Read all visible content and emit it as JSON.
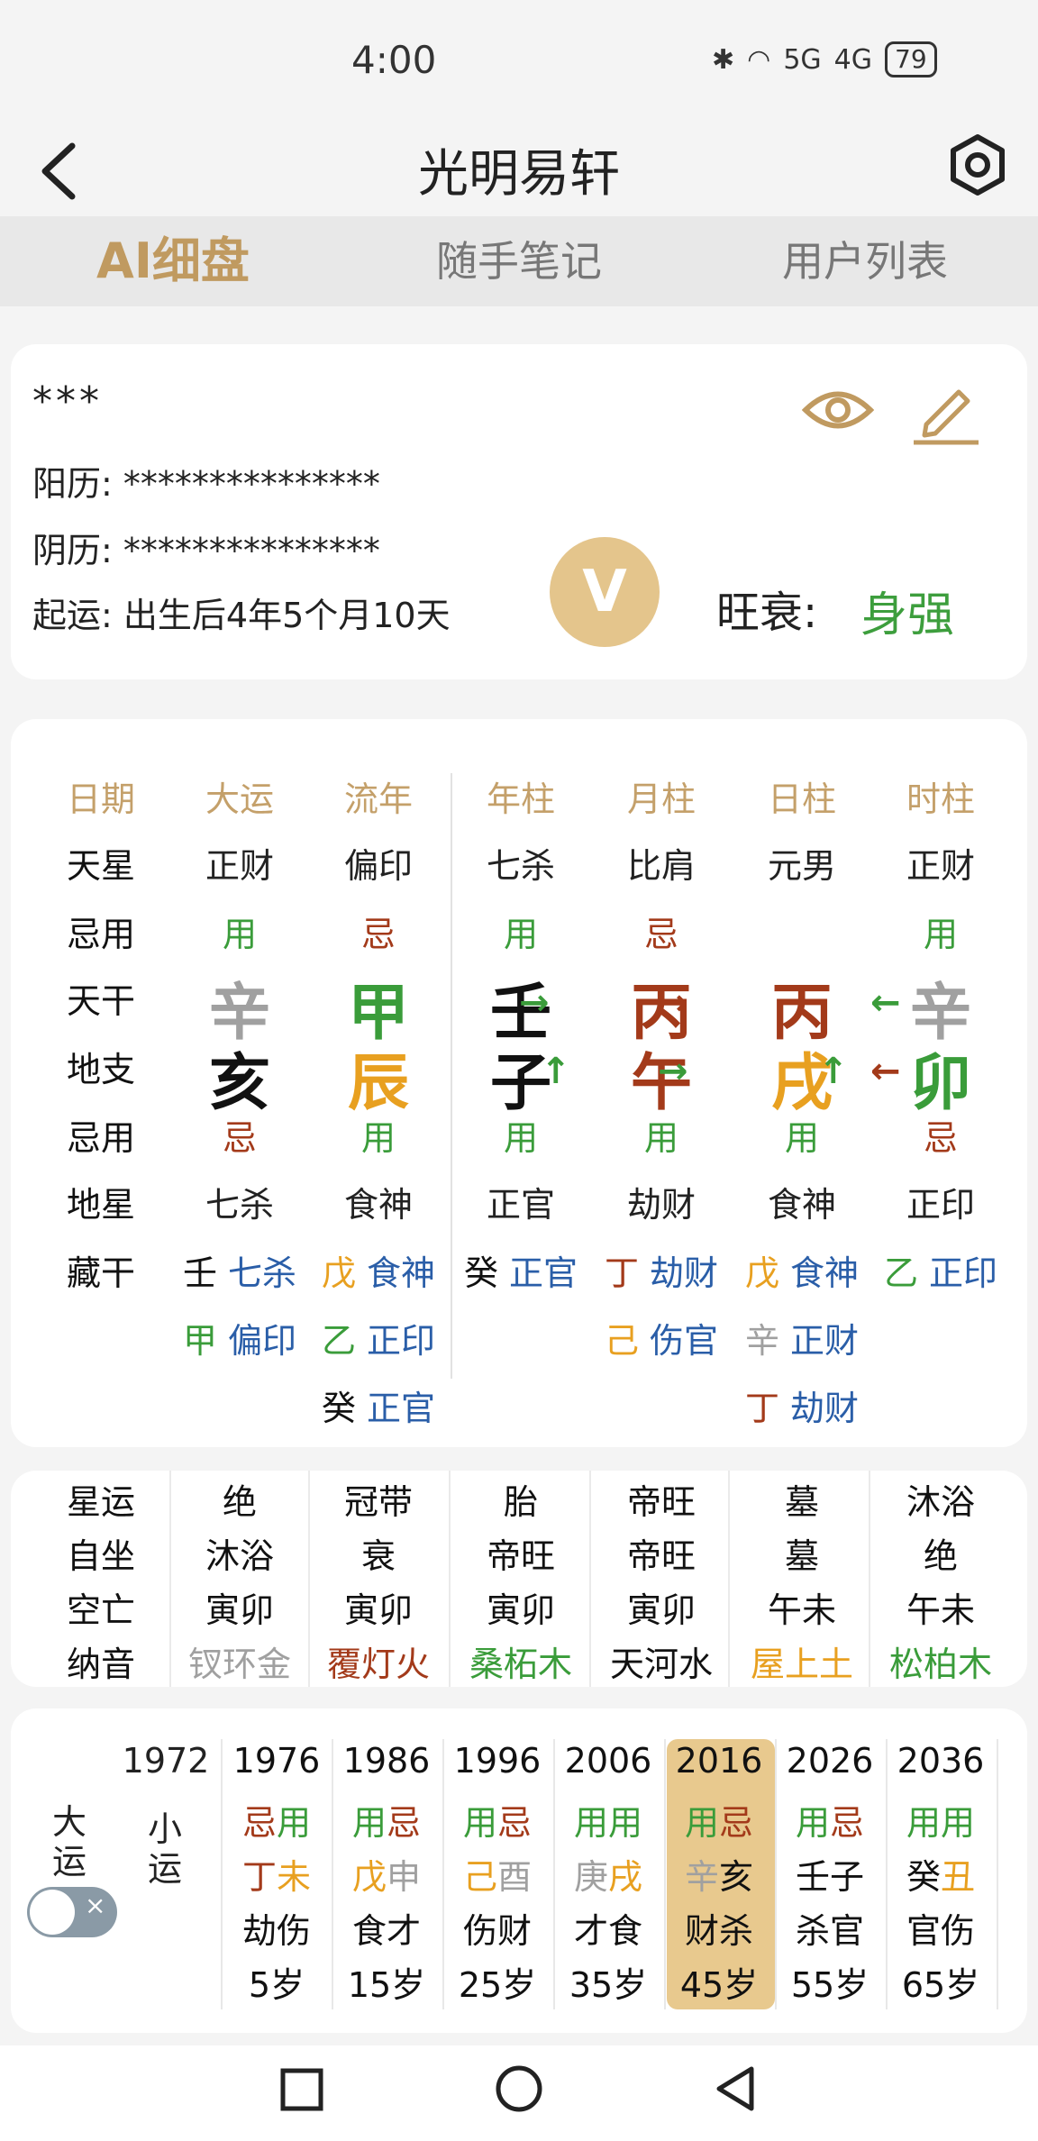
{
  "status": {
    "time": "4:00",
    "battery": "79",
    "signal1": "5G",
    "signal2": "4G"
  },
  "header": {
    "title": "光明易轩"
  },
  "tabs": [
    "AI细盘",
    "随手笔记",
    "用户列表"
  ],
  "profile": {
    "name": "***",
    "solar_label": "阳历:",
    "solar_value": "***************",
    "lunar_label": "阴历:",
    "lunar_value": "***************",
    "qiyun_label": "起运:",
    "qiyun_value": "出生后4年5个月10天",
    "vip_label": "V",
    "wangshuai_label": "旺衰:",
    "wangshuai_value": "身强"
  },
  "pillars": {
    "headers": [
      "日期",
      "大运",
      "流年",
      "年柱",
      "月柱",
      "日柱",
      "时柱"
    ],
    "rows": [
      [
        "天星",
        "正财",
        "偏印",
        "七杀",
        "比肩",
        "元男",
        "正财"
      ],
      [
        "忌用",
        "用",
        "忌",
        "用",
        "忌",
        "",
        "用"
      ],
      [
        "天干",
        "辛",
        "甲",
        "壬",
        "丙",
        "丙",
        "辛"
      ],
      [
        "地支",
        "亥",
        "辰",
        "子",
        "午",
        "戌",
        "卯"
      ],
      [
        "忌用",
        "忌",
        "用",
        "用",
        "用",
        "用",
        "忌"
      ],
      [
        "地星",
        "七杀",
        "食神",
        "正官",
        "劫财",
        "食神",
        "正印"
      ]
    ],
    "canggan_label": "藏干",
    "canggan": [
      [
        [
          "壬",
          "七杀"
        ],
        [
          "甲",
          "偏印"
        ]
      ],
      [
        [
          "戊",
          "食神"
        ],
        [
          "乙",
          "正印"
        ],
        [
          "癸",
          "正官"
        ]
      ],
      [
        [
          "癸",
          "正官"
        ]
      ],
      [
        [
          "丁",
          "劫财"
        ],
        [
          "己",
          "伤官"
        ]
      ],
      [
        [
          "戊",
          "食神"
        ],
        [
          "辛",
          "正财"
        ],
        [
          "丁",
          "劫财"
        ]
      ],
      [
        [
          "乙",
          "正印"
        ]
      ]
    ],
    "arrows": {
      "year_stem": "→",
      "year_branch": "↑",
      "month_stem": "→",
      "month_branch": "→",
      "day_branch": "↑",
      "hour_stem": "←",
      "hour_branch": "←"
    }
  },
  "extra": {
    "labels": [
      "星运",
      "自坐",
      "空亡",
      "纳音"
    ],
    "cols": [
      [
        "绝",
        "沐浴",
        "寅卯",
        "钗环金"
      ],
      [
        "冠带",
        "衰",
        "寅卯",
        "覆灯火"
      ],
      [
        "胎",
        "帝旺",
        "寅卯",
        "桑柘木"
      ],
      [
        "帝旺",
        "帝旺",
        "寅卯",
        "天河水"
      ],
      [
        "墓",
        "墓",
        "午未",
        "屋上土"
      ],
      [
        "沐浴",
        "绝",
        "午未",
        "松柏木"
      ]
    ]
  },
  "dayun": {
    "label": "大运",
    "xiaoyun": "小运",
    "first_year": "1972",
    "cols": [
      {
        "year": "1976",
        "jy": [
          "忌",
          "用"
        ],
        "gz": [
          "丁",
          "未"
        ],
        "ss": "劫伤",
        "age": "5岁"
      },
      {
        "year": "1986",
        "jy": [
          "用",
          "忌"
        ],
        "gz": [
          "戊",
          "申"
        ],
        "ss": "食才",
        "age": "15岁"
      },
      {
        "year": "1996",
        "jy": [
          "用",
          "忌"
        ],
        "gz": [
          "己",
          "酉"
        ],
        "ss": "伤财",
        "age": "25岁"
      },
      {
        "year": "2006",
        "jy": [
          "用",
          "用"
        ],
        "gz": [
          "庚",
          "戌"
        ],
        "ss": "才食",
        "age": "35岁"
      },
      {
        "year": "2016",
        "jy": [
          "用",
          "忌"
        ],
        "gz": [
          "辛",
          "亥"
        ],
        "ss": "财杀",
        "age": "45岁"
      },
      {
        "year": "2026",
        "jy": [
          "用",
          "忌"
        ],
        "gz": [
          "壬",
          "子"
        ],
        "ss": "杀官",
        "age": "55岁"
      },
      {
        "year": "2036",
        "jy": [
          "用",
          "用"
        ],
        "gz": [
          "癸",
          "丑"
        ],
        "ss": "官伤",
        "age": "65岁"
      }
    ]
  },
  "colors": {
    "accent": "#c09a60",
    "green": "#3a9c3a",
    "red": "#a33a1a",
    "orange": "#e8a020",
    "blue": "#2a5ea8",
    "highlight": "#e8c98e"
  }
}
